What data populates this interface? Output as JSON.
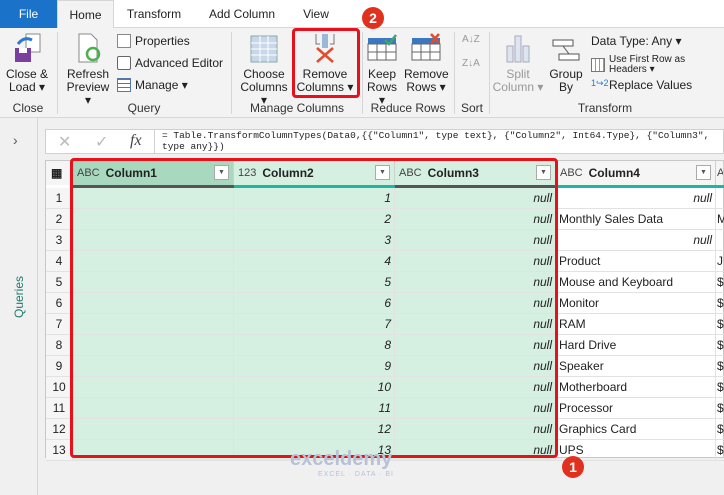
{
  "tabs": [
    "File",
    "Home",
    "Transform",
    "Add Column",
    "View"
  ],
  "ribbon": {
    "close_load": "Close &",
    "close_load2": "Load ▾",
    "close_group": "Close",
    "refresh": "Refresh",
    "refresh2": "Preview ▾",
    "properties": "Properties",
    "advanced_editor": "Advanced Editor",
    "manage": "Manage ▾",
    "query_group": "Query",
    "choose": "Choose",
    "choose2": "Columns ▾",
    "remove": "Remove",
    "remove2": "Columns ▾",
    "manage_columns_group": "Manage Columns",
    "keep": "Keep",
    "keep2": "Rows ▾",
    "remove_rows": "Remove",
    "remove_rows2": "Rows ▾",
    "reduce_rows_group": "Reduce Rows",
    "sort_az": "A↓Z",
    "sort_za": "Z↓A",
    "sort_group": "Sort",
    "split": "Split",
    "split2": "Column ▾",
    "group": "Group",
    "group2": "By",
    "data_type": "Data Type: Any ▾",
    "first_row": "Use First Row as Headers ▾",
    "replace": "Replace Values",
    "transform_group": "Transform"
  },
  "queries_label": "Queries",
  "formula": {
    "cancel": "✕",
    "confirm": "✓",
    "fx": "fx",
    "text": "= Table.TransformColumnTypes(Data0,{{\"Column1\", type text}, {\"Column2\", Int64.Type}, {\"Column3\", type any}})"
  },
  "columns": [
    {
      "type": "ABC",
      "name": "Column1"
    },
    {
      "type": "123",
      "name": "Column2"
    },
    {
      "type": "ABC",
      "name": "Column3"
    },
    {
      "type": "ABC",
      "name": "Column4"
    },
    {
      "type": "A",
      "name": ""
    }
  ],
  "rows": [
    {
      "n": "1",
      "c2": "1",
      "c3": "null",
      "c4": "null",
      "c4null": true,
      "c5": ""
    },
    {
      "n": "2",
      "c2": "2",
      "c3": "null",
      "c4": "Monthly Sales Data",
      "c5": "M"
    },
    {
      "n": "3",
      "c2": "3",
      "c3": "null",
      "c4": "null",
      "c4null": true,
      "c5": ""
    },
    {
      "n": "4",
      "c2": "4",
      "c3": "null",
      "c4": "Product",
      "c5": "J"
    },
    {
      "n": "5",
      "c2": "5",
      "c3": "null",
      "c4": "Mouse and Keyboard",
      "c5": "$"
    },
    {
      "n": "6",
      "c2": "6",
      "c3": "null",
      "c4": "Monitor",
      "c5": "$"
    },
    {
      "n": "7",
      "c2": "7",
      "c3": "null",
      "c4": "RAM",
      "c5": "$"
    },
    {
      "n": "8",
      "c2": "8",
      "c3": "null",
      "c4": "Hard Drive",
      "c5": "$"
    },
    {
      "n": "9",
      "c2": "9",
      "c3": "null",
      "c4": "Speaker",
      "c5": "$"
    },
    {
      "n": "10",
      "c2": "10",
      "c3": "null",
      "c4": "Motherboard",
      "c5": "$"
    },
    {
      "n": "11",
      "c2": "11",
      "c3": "null",
      "c4": "Processor",
      "c5": "$"
    },
    {
      "n": "12",
      "c2": "12",
      "c3": "null",
      "c4": "Graphics Card",
      "c5": "$"
    },
    {
      "n": "13",
      "c2": "13",
      "c3": "null",
      "c4": "UPS",
      "c5": "$"
    }
  ],
  "badges": [
    "1",
    "2"
  ],
  "watermark": "exceldemy",
  "watermark_sub": "EXCEL · DATA · BI"
}
